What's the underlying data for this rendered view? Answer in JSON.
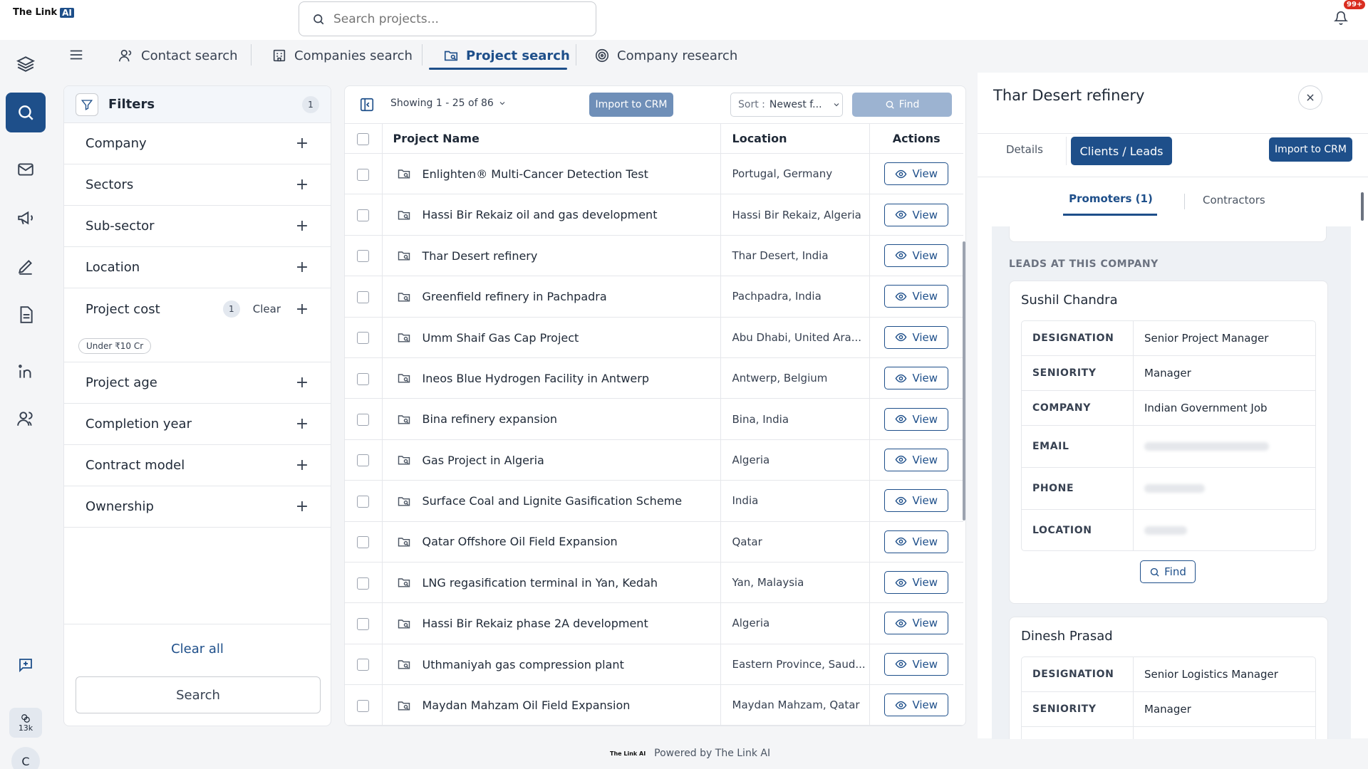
{
  "app": {
    "logo_text": "The Link",
    "logo_ai": "AI",
    "notification_badge": "99+"
  },
  "search": {
    "placeholder": "Search projects..."
  },
  "nav_tabs": [
    {
      "label": "Contact search"
    },
    {
      "label": "Companies search"
    },
    {
      "label": "Project search",
      "active": true
    },
    {
      "label": "Company research"
    }
  ],
  "rail": {
    "credits": "13k",
    "avatar_initial": "C"
  },
  "filters": {
    "title": "Filters",
    "count": "1",
    "items": [
      {
        "label": "Company"
      },
      {
        "label": "Sectors"
      },
      {
        "label": "Sub-sector"
      },
      {
        "label": "Location"
      },
      {
        "label": "Project cost",
        "count": "1",
        "clear": "Clear",
        "chip": "Under ₹10 Cr"
      },
      {
        "label": "Project age"
      },
      {
        "label": "Completion year"
      },
      {
        "label": "Contract model"
      },
      {
        "label": "Ownership"
      }
    ],
    "clear_all": "Clear all",
    "search_button": "Search"
  },
  "table": {
    "showing": "Showing 1 - 25 of 86",
    "import_label": "Import to CRM",
    "sort_label": "Sort :",
    "sort_value": "Newest f...",
    "find_label": "Find",
    "columns": {
      "name": "Project Name",
      "location": "Location",
      "actions": "Actions"
    },
    "view_label": "View",
    "rows": [
      {
        "name": "Enlighten® Multi-Cancer Detection Test",
        "location": "Portugal, Germany"
      },
      {
        "name": "Hassi Bir Rekaiz oil and gas development",
        "location": "Hassi Bir Rekaiz, Algeria"
      },
      {
        "name": "Thar Desert refinery",
        "location": "Thar Desert, India"
      },
      {
        "name": "Greenfield refinery in Pachpadra",
        "location": "Pachpadra, India"
      },
      {
        "name": "Umm Shaif Gas Cap Project",
        "location": "Abu Dhabi, United Ara..."
      },
      {
        "name": "Ineos Blue Hydrogen Facility in Antwerp",
        "location": "Antwerp, Belgium"
      },
      {
        "name": "Bina refinery expansion",
        "location": "Bina, India"
      },
      {
        "name": "Gas Project in Algeria",
        "location": "Algeria"
      },
      {
        "name": "Surface Coal and Lignite Gasification Scheme",
        "location": "India"
      },
      {
        "name": "Qatar Offshore Oil Field Expansion",
        "location": "Qatar"
      },
      {
        "name": "LNG regasification terminal in Yan, Kedah",
        "location": "Yan, Malaysia"
      },
      {
        "name": "Hassi Bir Rekaiz phase 2A development",
        "location": "Algeria"
      },
      {
        "name": "Uthmaniyah gas compression plant",
        "location": "Eastern Province, Saud..."
      },
      {
        "name": "Maydan Mahzam Oil Field Expansion",
        "location": "Maydan Mahzam, Qatar"
      }
    ]
  },
  "detail": {
    "title": "Thar Desert refinery",
    "tabs": {
      "details": "Details",
      "clients": "Clients / Leads"
    },
    "import_label": "Import to CRM",
    "subtabs": {
      "promoters": "Promoters (1)",
      "contractors": "Contractors"
    },
    "leads_label": "LEADS AT THIS COMPANY",
    "find_label": "Find",
    "leads": [
      {
        "name": "Sushil Chandra",
        "fields": [
          {
            "key": "DESIGNATION",
            "value": "Senior Project Manager"
          },
          {
            "key": "SENIORITY",
            "value": "Manager"
          },
          {
            "key": "COMPANY",
            "value": "Indian Government Job"
          },
          {
            "key": "EMAIL",
            "value": ""
          },
          {
            "key": "PHONE",
            "value": ""
          },
          {
            "key": "LOCATION",
            "value": ""
          }
        ]
      },
      {
        "name": "Dinesh Prasad",
        "fields": [
          {
            "key": "DESIGNATION",
            "value": "Senior Logistics Manager"
          },
          {
            "key": "SENIORITY",
            "value": "Manager"
          }
        ]
      }
    ]
  },
  "footer": {
    "text": "Powered by The Link AI",
    "mini_logo": "The Link AI"
  },
  "colors": {
    "primary": "#1e4f8a",
    "primary_muted": "#6f8fb8",
    "background": "#f4f5f7"
  }
}
